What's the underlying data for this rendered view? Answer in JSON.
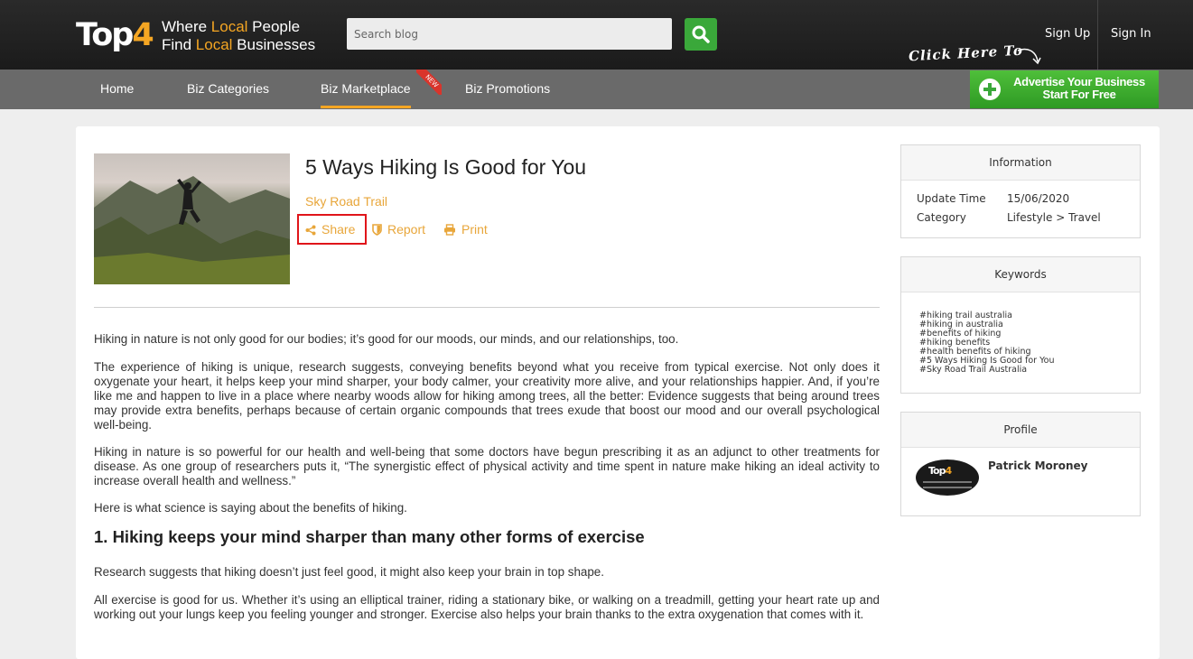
{
  "header": {
    "logo_text_a": "Top",
    "logo_text_b": "4",
    "tagline_1a": "Where ",
    "tagline_1b": "Local",
    "tagline_1c": " People",
    "tagline_2a": "Find ",
    "tagline_2b": "Local",
    "tagline_2c": " Businesses",
    "search_placeholder": "Search blog",
    "sign_up": "Sign Up",
    "sign_in": "Sign In",
    "click_here": "Click Here To"
  },
  "nav": {
    "items": [
      "Home",
      "Biz Categories",
      "Biz Marketplace",
      "Biz Promotions"
    ],
    "active": "Biz Marketplace",
    "new_badge": "NEW",
    "advertise_line1": "Advertise Your Business",
    "advertise_line2": "Start For Free"
  },
  "article": {
    "title": "5 Ways Hiking Is Good for You",
    "author": "Sky Road Trail",
    "actions": {
      "share": "Share",
      "report": "Report",
      "print": "Print"
    },
    "paragraphs": [
      "Hiking in nature is not only good for our bodies; it’s good for our moods, our minds, and our relationships, too.",
      "The experience of hiking is unique, research suggests, conveying benefits beyond what you receive from typical exercise. Not only does it oxygenate your heart, it helps keep your mind sharper, your body calmer, your creativity more alive, and your relationships happier. And, if you’re like me and happen to live in a place where nearby woods allow for hiking among trees, all the better: Evidence suggests that being around trees may provide extra benefits, perhaps because of certain organic compounds that trees exude that boost our mood and our overall psychological well-being.",
      "Hiking in nature is so powerful for our health and well-being that some doctors have begun prescribing it as an adjunct to other treatments for disease. As one group of researchers puts it, “The synergistic effect of physical activity and time spent in nature make hiking an ideal activity to increase overall health and wellness.”",
      "Here is what science is saying about the benefits of hiking."
    ],
    "section_heading": "1. Hiking keeps your mind sharper than many other forms of exercise",
    "section_paragraphs": [
      "Research suggests that hiking doesn’t just feel good, it might also keep your brain in top shape.",
      "All exercise is good for us. Whether it’s using an elliptical trainer, riding a stationary bike, or walking on a treadmill, getting your heart rate up and working out your lungs keep you feeling younger and stronger. Exercise also helps your brain thanks to the extra oxygenation that comes with it."
    ]
  },
  "sidebar": {
    "information": {
      "title": "Information",
      "update_label": "Update Time",
      "update_value": "15/06/2020",
      "category_label": "Category",
      "category_value": "Lifestyle > Travel"
    },
    "keywords": {
      "title": "Keywords",
      "items": [
        "#hiking trail australia",
        "#hiking in australia",
        "#benefits of hiking",
        "#hiking benefits",
        "#health benefits of hiking",
        "#5 Ways Hiking Is Good for You",
        "#Sky Road Trail Australia"
      ]
    },
    "profile": {
      "title": "Profile",
      "name": "Patrick Moroney",
      "avatar_text_a": "Top",
      "avatar_text_b": "4"
    }
  },
  "colors": {
    "accent_orange": "#f5a623",
    "link_orange": "#e8a63a",
    "green": "#3aa83a",
    "highlight_red": "#e0151a",
    "nav_gray": "#6a6a6a"
  },
  "icons": [
    "search-icon",
    "share-icon",
    "report-icon",
    "print-icon",
    "plus-icon",
    "arrow-icon"
  ]
}
